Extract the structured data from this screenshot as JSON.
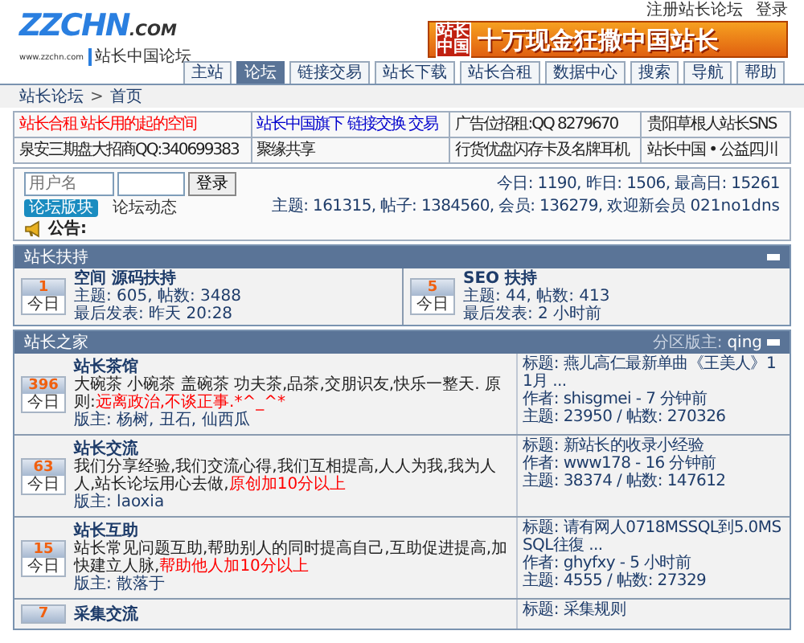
{
  "header": {
    "links": [
      "注册站长论坛",
      "登录"
    ],
    "logo": {
      "mark": "ZZCHN",
      "suffix": ".COM",
      "url": "www.zzchn.com",
      "name": "站长中国论坛"
    },
    "banner": {
      "badge": "站长中国",
      "text": "十万现金狂撒中国站长"
    }
  },
  "nav": [
    {
      "label": "主站",
      "selected": false
    },
    {
      "label": "论坛",
      "selected": true
    },
    {
      "label": "链接交易",
      "selected": false
    },
    {
      "label": "站长下载",
      "selected": false
    },
    {
      "label": "站长合租",
      "selected": false
    },
    {
      "label": "数据中心",
      "selected": false
    },
    {
      "label": "搜索",
      "selected": false
    },
    {
      "label": "导航",
      "selected": false
    },
    {
      "label": "帮助",
      "selected": false
    }
  ],
  "breadcrumb": {
    "items": [
      "站长论坛",
      "首页"
    ],
    "separator": ">"
  },
  "ads": [
    {
      "text": "站长合租  站长用的起的空间",
      "color": "#ff0000"
    },
    {
      "text": "站长中国旗下  链接交换  交易",
      "color": "#0000cc"
    },
    {
      "text": "广告位招租:QQ 8279670",
      "color": "#222222"
    },
    {
      "text": "贵阳草根人站长SNS",
      "color": "#222222"
    },
    {
      "text": "泉安三期盘大招商QQ:340699383",
      "color": "#222222"
    },
    {
      "text": "聚缘共享",
      "color": "#222222"
    },
    {
      "text": "行货优盘闪存卡及名牌耳机",
      "color": "#222222"
    },
    {
      "text": "站长中国 • 公益四川",
      "color": "#222222"
    }
  ],
  "login": {
    "username": {
      "placeholder": "用户名"
    },
    "button": "登录"
  },
  "stats": {
    "daily": "今日: 1190, 昨日: 1506, 最高日: 15261",
    "totals": "主题: 161315, 帖子: 1384560, 会员: 136279, 欢迎新会员",
    "newest_member": "021no1dns"
  },
  "view_tabs": [
    {
      "label": "论坛版块",
      "selected": true
    },
    {
      "label": "论坛动态",
      "selected": false
    }
  ],
  "announcement": {
    "label": "公告:"
  },
  "sections": [
    {
      "kind": "grid",
      "title": "站长扶持",
      "forums": [
        {
          "today": "1",
          "today_label": "今日",
          "name": "空间 源码扶持",
          "stats": "主题: 605, 帖数: 3488",
          "last": "最后发表: 昨天 20:28"
        },
        {
          "today": "5",
          "today_label": "今日",
          "name": "SEO 扶持",
          "stats": "主题: 44, 帖数: 413",
          "last": "最后发表: 2 小时前"
        }
      ]
    },
    {
      "kind": "list",
      "title": "站长之家",
      "moderator_label": "分区版主:",
      "moderator": "qing",
      "forums": [
        {
          "today": "396",
          "today_label": "今日",
          "name": "站长茶馆",
          "description": "大碗茶 小碗茶 盖碗茶 功夫茶,品茶,交朋识友,快乐一整天. 原则:",
          "highlight": "远离政治,不谈正事.*^_^*",
          "moderators": "版主: 杨树, 丑石, 仙西瓜",
          "last_title": "标题: 燕儿高仁最新单曲《王美人》11月 ...",
          "last_author": "作者: shisgmei - 7 分钟前",
          "counts": "主题: 23950 / 帖数: 270326"
        },
        {
          "today": "63",
          "today_label": "今日",
          "name": "站长交流",
          "description": "我们分享经验,我们交流心得,我们互相提高,人人为我,我为人人,站长论坛用心去做,",
          "highlight": "原创加10分以上",
          "moderators": "版主: laoxia",
          "last_title": "标题: 新站长的收录小经验",
          "last_author": "作者: www178 - 16 分钟前",
          "counts": "主题: 38374 / 帖数: 147612"
        },
        {
          "today": "15",
          "today_label": "今日",
          "name": "站长互助",
          "description": "站长常见问题互助,帮助别人的同时提高自己,互助促进提高,加快建立人脉,",
          "highlight": "帮助他人加10分以上",
          "moderators": "版主: 散落于",
          "last_title": "标题: 请有网人0718MSSQL到5.0MSSQL往復 ...",
          "last_author": "作者: ghyfxy - 5 小时前",
          "counts": "主题: 4555 / 帖数: 27329"
        },
        {
          "today": "7",
          "name": "采集交流",
          "last_title": "标题: 采集规则"
        }
      ]
    }
  ]
}
